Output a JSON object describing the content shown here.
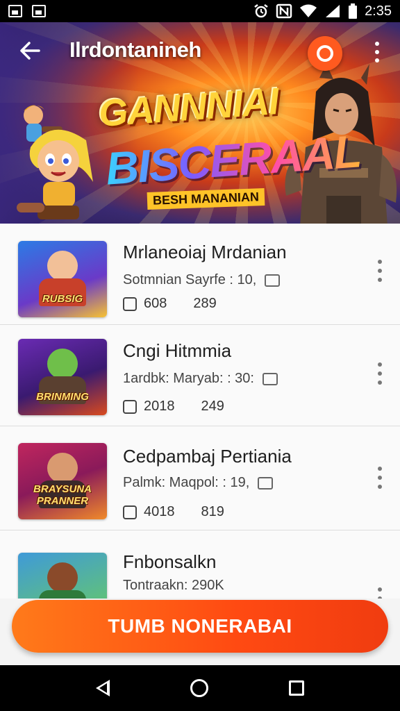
{
  "status_bar": {
    "time": "2:35",
    "left_icons": [
      "image-icon",
      "image-icon"
    ],
    "right_icons": [
      "alarm-icon",
      "nfc-icon",
      "wifi-icon",
      "signal-icon",
      "battery-icon"
    ]
  },
  "header": {
    "title": "Ilrdontanineh",
    "back_icon": "arrow-left-icon",
    "brand_icon": "brand-logo-icon",
    "more_icon": "more-vertical-icon"
  },
  "hero": {
    "title": "GANNNIAI",
    "subtitle": "BISCERAAL",
    "tagline": "BESH MANANIAN"
  },
  "list": {
    "items": [
      {
        "title": "Mrlaneoiaj Mrdanian",
        "meta": "Sotmnian Sayrfe : 10,",
        "stat_a": "608",
        "stat_b": "289",
        "thumb_label": "RUBSIG",
        "colors": [
          "#2c7be5",
          "#f7c233"
        ]
      },
      {
        "title": "Cngi Hitmmia",
        "meta": "1ardbk: Maryab: : 30:",
        "stat_a": "2018",
        "stat_b": "249",
        "thumb_label": "BRINMING",
        "colors": [
          "#6a2bb3",
          "#d94a1e"
        ]
      },
      {
        "title": "Cedpambaj Pertiania",
        "meta": "Palmk: Maqpol: : 19,",
        "stat_a": "4018",
        "stat_b": "819",
        "thumb_label": "BRAYSUNA PRANNER",
        "colors": [
          "#c0265e",
          "#f08a2a"
        ]
      },
      {
        "title": "Fnbonsalkn",
        "meta": "Tontraakn: 290K",
        "stat_a": "",
        "stat_b": "",
        "thumb_label": "",
        "colors": [
          "#3f9ad8",
          "#6ccf5a"
        ]
      }
    ]
  },
  "cta": {
    "label": "TUMB NONERABAI"
  },
  "nav": {
    "back_icon": "nav-back-icon",
    "home_icon": "nav-home-icon",
    "recent_icon": "nav-recent-icon"
  },
  "theme": {
    "accent": "#ff5a1f",
    "cta_gradient": [
      "#ff7a1a",
      "#f03c10"
    ]
  }
}
